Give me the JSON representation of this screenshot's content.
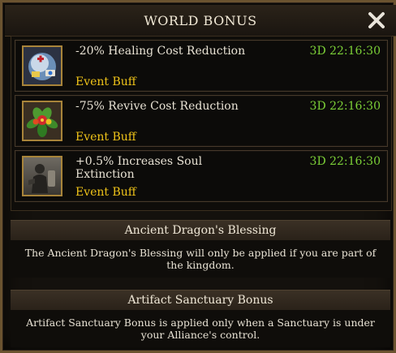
{
  "window": {
    "title": "WORLD BONUS",
    "close_icon": "close-x-icon",
    "accent_color": "#f0c419",
    "timer_color": "#7cd037"
  },
  "buffs": [
    {
      "name": "-20% Healing Cost Reduction",
      "type": "Event Buff",
      "timer": "3D 22:16:30",
      "icon": "healing-orb-icon"
    },
    {
      "name": "-75% Revive Cost Reduction",
      "type": "Event Buff",
      "timer": "3D 22:16:30",
      "icon": "revive-flower-icon"
    },
    {
      "name": "+0.5% Increases Soul Extinction",
      "type": "Event Buff",
      "timer": "3D 22:16:30",
      "icon": "soul-knight-icon"
    }
  ],
  "sections": [
    {
      "title": "Ancient Dragon's Blessing",
      "text": "The Ancient Dragon's Blessing will only be applied if you are part of the kingdom."
    },
    {
      "title": "Artifact Sanctuary Bonus",
      "text": "Artifact Sanctuary Bonus is applied only when a Sanctuary is under your Alliance's control."
    }
  ]
}
